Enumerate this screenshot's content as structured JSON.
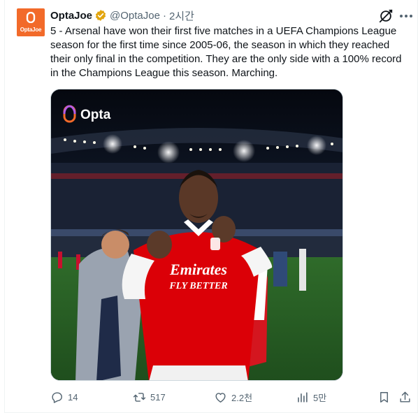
{
  "author": {
    "name": "OptaJoe",
    "handle": "@OptaJoe",
    "separator": "·",
    "time": "2시간",
    "avatar_text": "OptaJoe"
  },
  "tweet": {
    "text": "5 - Arsenal have won their first five matches in a UEFA Champions League season for the first time since 2005-06, the season in which they reached their only final in the competition. They are the only side with a 100% record in the Champions League this season. Marching."
  },
  "media": {
    "logo_text": "Opta",
    "sponsor_line1": "Emirates",
    "sponsor_line2": "FLY BETTER"
  },
  "actions": {
    "replies": "14",
    "reposts": "517",
    "likes": "2.2천",
    "views": "5만"
  },
  "colors": {
    "verified": "#e2a50e",
    "opta_orange": "#f26a2a",
    "text_secondary": "#536471"
  },
  "icons": [
    "grok-icon",
    "more-icon",
    "verified-badge-icon",
    "reply-icon",
    "repost-icon",
    "like-icon",
    "views-icon",
    "bookmark-icon",
    "share-icon"
  ]
}
